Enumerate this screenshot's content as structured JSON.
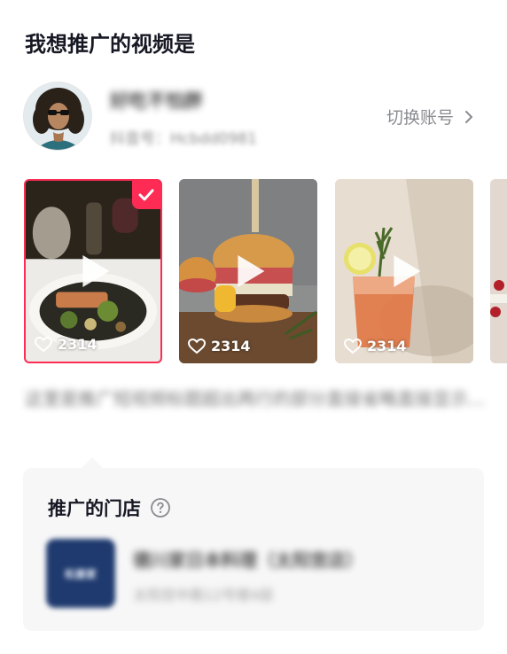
{
  "page_title": "我想推广的视频是",
  "account": {
    "name": "好吃不怕胖",
    "douyin_id": "抖音号：Hcbdd0981",
    "switch_label": "切换账号"
  },
  "videos": [
    {
      "likes": "2314",
      "selected": true
    },
    {
      "likes": "2314",
      "selected": false
    },
    {
      "likes": "2314",
      "selected": false
    }
  ],
  "video_description": "这里是推广短视频标题超出两行的部分直接省略直接显示...",
  "store": {
    "section_title": "推广的门店",
    "logo_text": "松屋家",
    "name": "德川家日本料理（太阳宫店）",
    "address": "太阳宫中路12号楼4层"
  },
  "colors": {
    "accent": "#fe2c55",
    "text_primary": "#161823",
    "text_secondary": "#8a8b91",
    "panel_bg": "#f7f7f8"
  }
}
